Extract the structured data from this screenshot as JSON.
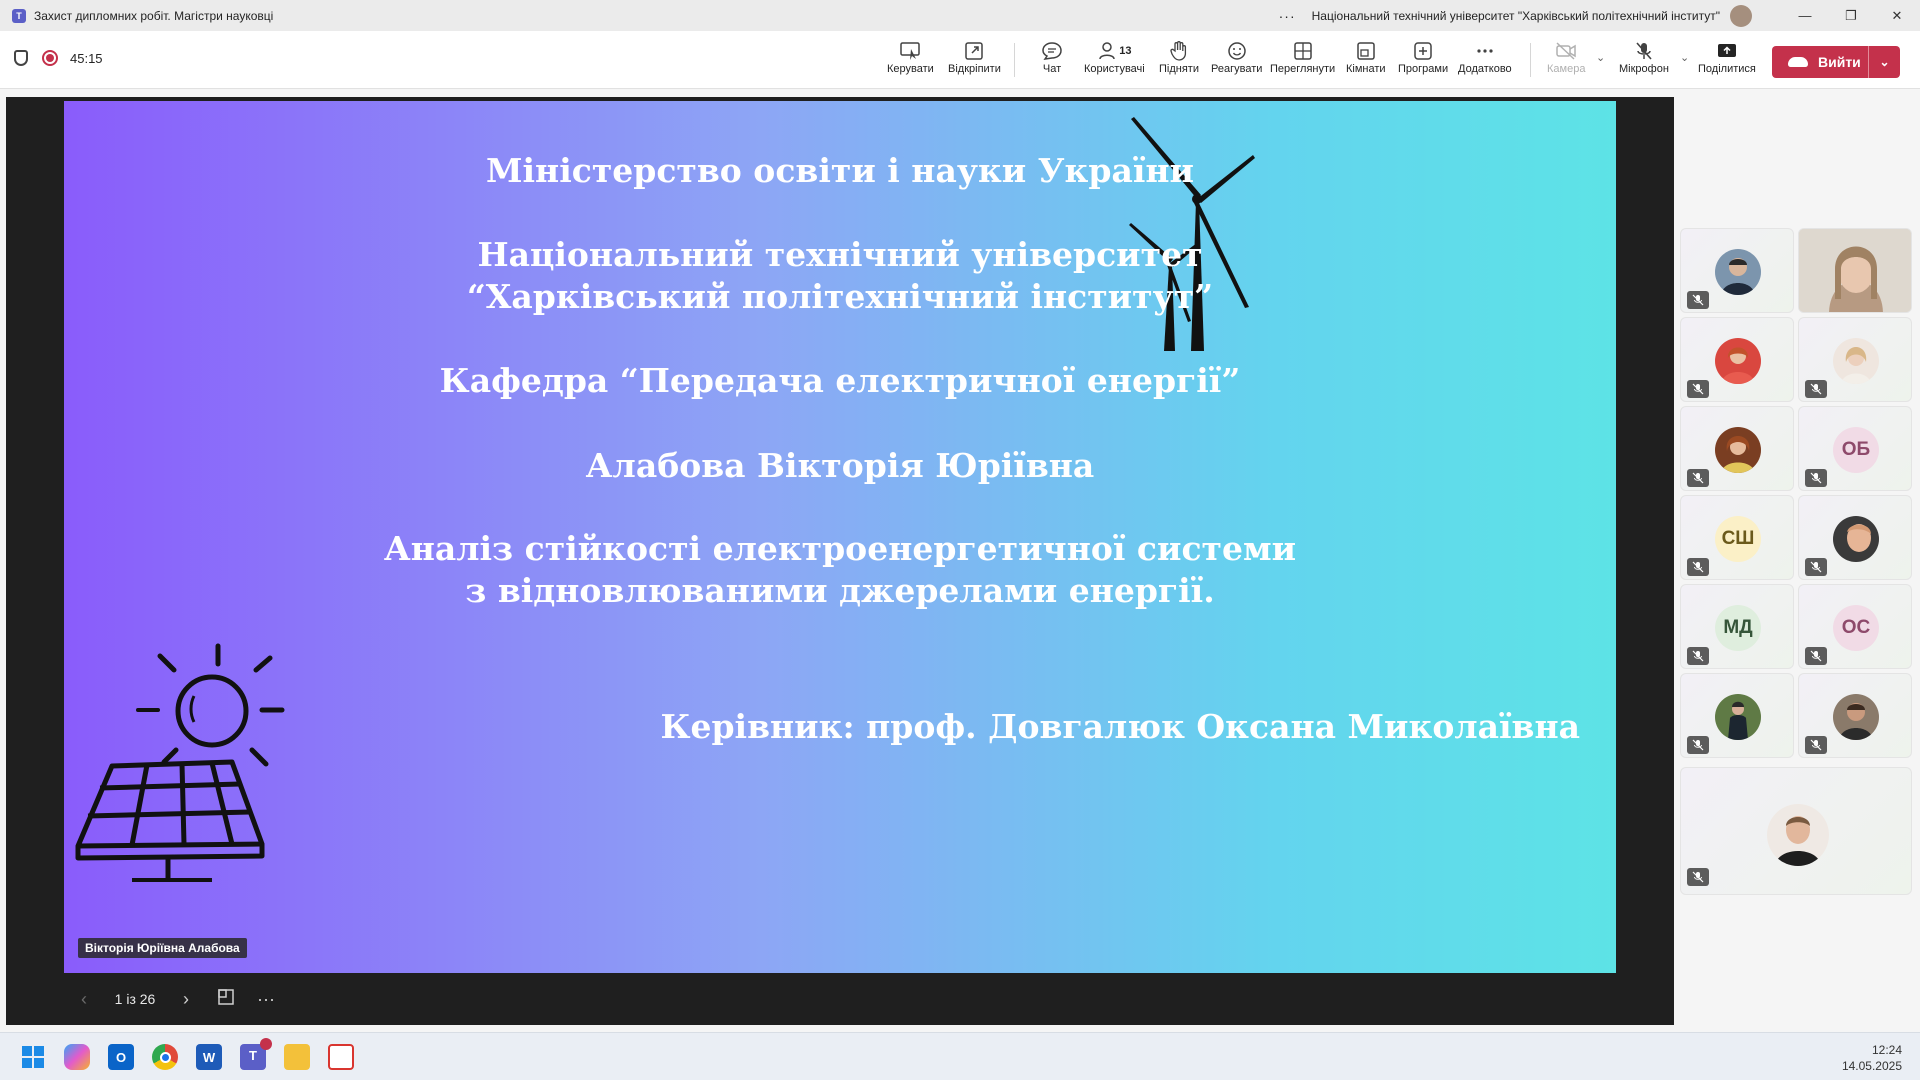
{
  "window": {
    "title": "Захист дипломних робіт. Магістри науковці",
    "org": "Національний технічний університет \"Харківський політехнічний інститут\"",
    "more": "···",
    "controls": [
      "—",
      "❐",
      "✕"
    ]
  },
  "toolbar": {
    "timer": "45:15",
    "buttons": [
      {
        "label": "Керувати",
        "icon": "share-screen-icon"
      },
      {
        "label": "Відкріпити",
        "icon": "popout-icon"
      },
      {
        "label": "Чат",
        "icon": "chat-icon"
      },
      {
        "label": "Користувачі",
        "icon": "people-icon",
        "badge": "13"
      },
      {
        "label": "Підняти",
        "icon": "raise-hand-icon"
      },
      {
        "label": "Реагувати",
        "icon": "react-icon"
      },
      {
        "label": "Переглянути",
        "icon": "view-icon"
      },
      {
        "label": "Кімнати",
        "icon": "rooms-icon"
      },
      {
        "label": "Програми",
        "icon": "apps-icon"
      },
      {
        "label": "Додатково",
        "icon": "more-icon"
      },
      {
        "label": "Камера",
        "icon": "camera-off-icon"
      },
      {
        "label": "Мікрофон",
        "icon": "mic-off-icon"
      },
      {
        "label": "Поділитися",
        "icon": "share-icon"
      }
    ],
    "leave_label": "Вийти",
    "leave_color": "#c4314b"
  },
  "slide": {
    "line1": "Міністерство освіти і науки України",
    "line2": "Національний технічний університет",
    "line3": "“Харківський політехнічний інститут”",
    "line4": "Кафедра “Передача електричної енергії”",
    "line5": "Алабова Вікторія Юріївна",
    "line6": "Аналіз стійкості електроенергетичної системи",
    "line7": "з відновлюваними джерелами енергії.",
    "line8": "Керівник: проф. Довгалюк Оксана Миколаївна",
    "presenter": "Вікторія Юріївна Алабова",
    "page": "1 із 26",
    "gradient": [
      "#8a5cfb",
      "#5de3e6"
    ]
  },
  "participants": [
    {
      "initials": "",
      "kind": "photo",
      "color": "#3e5b7a"
    },
    {
      "initials": "",
      "kind": "video",
      "color": "#c9b29e"
    },
    {
      "initials": "",
      "kind": "photo",
      "color": "#d9473f"
    },
    {
      "initials": "",
      "kind": "photo",
      "color": "#e8d2c4"
    },
    {
      "initials": "",
      "kind": "photo",
      "color": "#8a4b2a"
    },
    {
      "initials": "ОБ",
      "kind": "initials",
      "color": "#f1dbe6",
      "text_color": "#8e4a6b"
    },
    {
      "initials": "СШ",
      "kind": "initials",
      "color": "#fbf0c7",
      "text_color": "#6b5a1b"
    },
    {
      "initials": "",
      "kind": "photo",
      "color": "#6e4f3c"
    },
    {
      "initials": "МД",
      "kind": "initials",
      "color": "#dfeede",
      "text_color": "#36563a"
    },
    {
      "initials": "ОС",
      "kind": "initials",
      "color": "#f1dbe6",
      "text_color": "#8e4a6b"
    },
    {
      "initials": "",
      "kind": "photo",
      "color": "#4d6b3a"
    },
    {
      "initials": "",
      "kind": "photo",
      "color": "#5a4a42"
    },
    {
      "initials": "",
      "kind": "photo",
      "color": "#caa18b"
    }
  ],
  "taskbar": {
    "apps": [
      "start-icon",
      "copilot-icon",
      "outlook-icon",
      "chrome-icon",
      "word-icon",
      "teams-icon",
      "explorer-icon",
      "snipping-icon"
    ],
    "time": "12:24",
    "date": "14.05.2025"
  }
}
